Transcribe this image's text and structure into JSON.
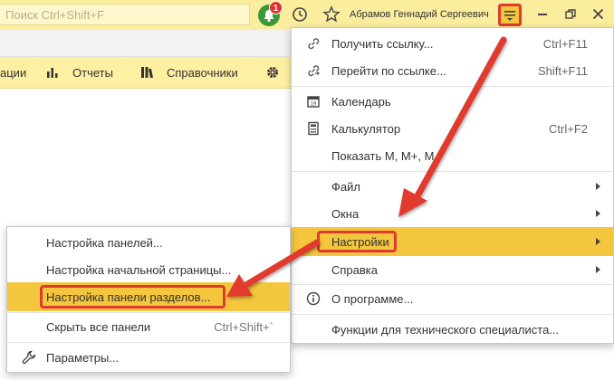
{
  "topbar": {
    "search_placeholder": "Поиск Ctrl+Shift+F",
    "notification_count": "1",
    "user_name": "Абрамов Геннадий Сергеевич"
  },
  "sections": {
    "items": [
      "ации",
      "Отчеты",
      "Справочники"
    ]
  },
  "main_menu": {
    "items": [
      {
        "label": "Получить ссылку...",
        "shortcut": "Ctrl+F11",
        "icon": "link-icon"
      },
      {
        "label": "Перейти по ссылке...",
        "shortcut": "Shift+F11",
        "icon": "goto-link-icon"
      },
      {
        "label": "Календарь",
        "shortcut": "",
        "icon": "calendar-icon"
      },
      {
        "label": "Калькулятор",
        "shortcut": "Ctrl+F2",
        "icon": "calculator-icon"
      },
      {
        "label": "Показать М, М+, М",
        "shortcut": "",
        "icon": ""
      },
      {
        "label": "Файл",
        "shortcut": "",
        "icon": ""
      },
      {
        "label": "Окна",
        "shortcut": "",
        "icon": ""
      },
      {
        "label": "Настройки",
        "shortcut": "",
        "icon": ""
      },
      {
        "label": "Справка",
        "shortcut": "",
        "icon": ""
      },
      {
        "label": "О программе...",
        "shortcut": "",
        "icon": "info-icon"
      },
      {
        "label": "Функции для технического специалиста...",
        "shortcut": "",
        "icon": ""
      }
    ]
  },
  "sub_menu": {
    "items": [
      {
        "label": "Настройка панелей...",
        "shortcut": ""
      },
      {
        "label": "Настройка начальной страницы...",
        "shortcut": ""
      },
      {
        "label": "Настройка панели разделов...",
        "shortcut": ""
      },
      {
        "label": "Скрыть все панели",
        "shortcut": "Ctrl+Shift+`"
      },
      {
        "label": "Параметры...",
        "shortcut": ""
      }
    ]
  },
  "colors": {
    "accent": "#f4c63d",
    "highlight": "#e03a2e",
    "topbar": "#fbed9e"
  }
}
